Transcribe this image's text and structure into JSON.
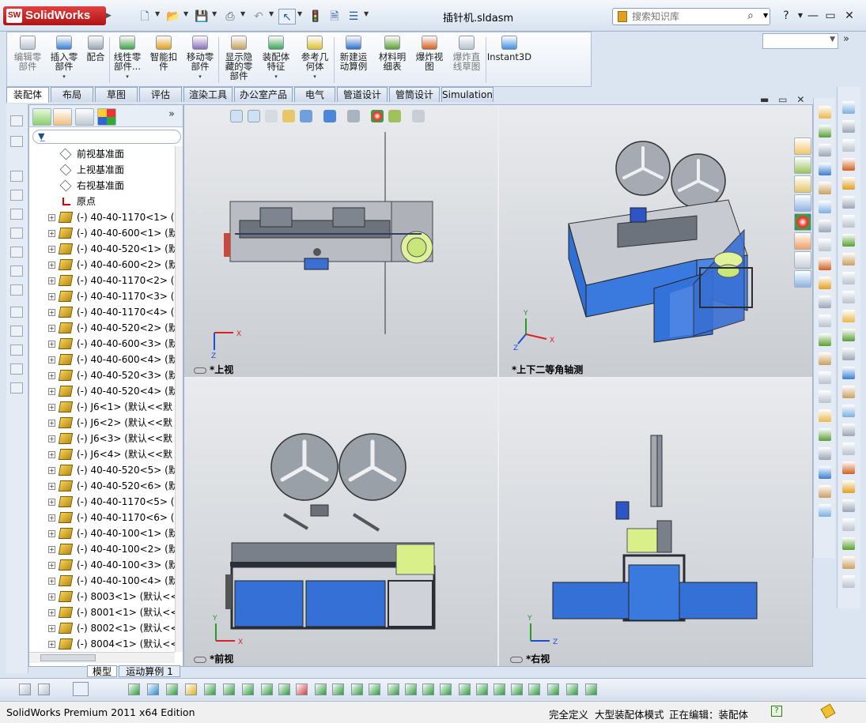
{
  "app": {
    "name": "SolidWorks",
    "logo_badge": "SW",
    "document_title": "插针机.sldasm",
    "edition": "SolidWorks Premium 2011 x64 Edition"
  },
  "search": {
    "placeholder": "搜索知识库",
    "value": ""
  },
  "window_controls": {
    "help": "?",
    "minimize": "—",
    "restore": "▭",
    "close": "✕"
  },
  "commands": [
    {
      "label": "编辑零\n部件",
      "disabled": true,
      "color": "#b9c2cf"
    },
    {
      "label": "插入零\n部件",
      "disabled": false,
      "color": "#3a7fd0",
      "dropdown": true
    },
    {
      "label": "配合",
      "disabled": false,
      "color": "#9ba6b4"
    },
    {
      "label": "线性零\n部件...",
      "disabled": false,
      "color": "#43a047",
      "dropdown": true
    },
    {
      "label": "智能扣\n件",
      "disabled": false,
      "color": "#e0a020"
    },
    {
      "label": "移动零\n部件",
      "disabled": false,
      "color": "#8a6fb8",
      "dropdown": true
    },
    {
      "label": "显示隐\n藏的零\n部件",
      "disabled": false,
      "color": "#c8a060"
    },
    {
      "label": "装配体\n特征",
      "disabled": false,
      "color": "#3fa357",
      "dropdown": true
    },
    {
      "label": "参考几\n何体",
      "disabled": false,
      "color": "#e0c030",
      "dropdown": true
    },
    {
      "label": "新建运\n动算例",
      "disabled": false,
      "color": "#3070c8"
    },
    {
      "label": "材料明\n细表",
      "disabled": false,
      "color": "#58a030"
    },
    {
      "label": "爆炸视\n图",
      "disabled": false,
      "color": "#d06020"
    },
    {
      "label": "爆炸直\n线草图",
      "disabled": true,
      "color": "#b9c2cf"
    },
    {
      "label": "Instant3D",
      "disabled": false,
      "color": "#4090e0"
    }
  ],
  "tabs": [
    "装配体",
    "布局",
    "草图",
    "评估",
    "渲染工具",
    "办公室产品",
    "电气",
    "管道设计",
    "管筒设计",
    "Simulation"
  ],
  "active_tab": "装配体",
  "feature_tree": [
    {
      "label": "前视基准面",
      "type": "plane"
    },
    {
      "label": "上视基准面",
      "type": "plane"
    },
    {
      "label": "右视基准面",
      "type": "plane"
    },
    {
      "label": "原点",
      "type": "origin"
    },
    {
      "label": "(-) 40-40-1170<1> (",
      "type": "part"
    },
    {
      "label": "(-) 40-40-600<1> (默",
      "type": "part"
    },
    {
      "label": "(-) 40-40-520<1> (默",
      "type": "part"
    },
    {
      "label": "(-) 40-40-600<2> (默",
      "type": "part"
    },
    {
      "label": "(-) 40-40-1170<2> (",
      "type": "part"
    },
    {
      "label": "(-) 40-40-1170<3> (",
      "type": "part"
    },
    {
      "label": "(-) 40-40-1170<4> (",
      "type": "part"
    },
    {
      "label": "(-) 40-40-520<2> (默",
      "type": "part"
    },
    {
      "label": "(-) 40-40-600<3> (默",
      "type": "part"
    },
    {
      "label": "(-) 40-40-600<4> (默",
      "type": "part"
    },
    {
      "label": "(-) 40-40-520<3> (默",
      "type": "part"
    },
    {
      "label": "(-) 40-40-520<4> (默",
      "type": "part"
    },
    {
      "label": "(-) J6<1> (默认<<默",
      "type": "part"
    },
    {
      "label": "(-) J6<2> (默认<<默",
      "type": "part"
    },
    {
      "label": "(-) J6<3> (默认<<默",
      "type": "part"
    },
    {
      "label": "(-) J6<4> (默认<<默",
      "type": "part"
    },
    {
      "label": "(-) 40-40-520<5> (默",
      "type": "part"
    },
    {
      "label": "(-) 40-40-520<6> (默",
      "type": "part"
    },
    {
      "label": "(-) 40-40-1170<5> (",
      "type": "part"
    },
    {
      "label": "(-) 40-40-1170<6> (",
      "type": "part"
    },
    {
      "label": "(-) 40-40-100<1> (默",
      "type": "part"
    },
    {
      "label": "(-) 40-40-100<2> (默",
      "type": "part"
    },
    {
      "label": "(-) 40-40-100<3> (默",
      "type": "part"
    },
    {
      "label": "(-) 40-40-100<4> (默",
      "type": "part"
    },
    {
      "label": "(-) 8003<1> (默认<<",
      "type": "part"
    },
    {
      "label": "(-) 8001<1> (默认<<",
      "type": "part"
    },
    {
      "label": "(-) 8002<1> (默认<<",
      "type": "part"
    },
    {
      "label": "(-) 8004<1> (默认<<",
      "type": "part"
    }
  ],
  "bottom_tabs": [
    "模型",
    "运动算例 1"
  ],
  "viewports": [
    {
      "label": "*上视",
      "triad": [
        "X",
        "Z"
      ]
    },
    {
      "label": "*上下二等角轴测",
      "triad": [
        "Y",
        "X",
        "Z"
      ]
    },
    {
      "label": "*前视",
      "triad": [
        "Y",
        "X"
      ]
    },
    {
      "label": "*右视",
      "triad": [
        "Y",
        "Z"
      ]
    }
  ],
  "status": {
    "fully_defined": "完全定义",
    "large_assembly": "大型装配体模式",
    "editing": "正在编辑：装配体",
    "help_badge": "?"
  },
  "colors": {
    "machine_blue": "#3570d6",
    "frame_dark": "#2a2d33",
    "bowl_green": "#d8ef8a",
    "reel_gray": "#9aa0a8"
  }
}
